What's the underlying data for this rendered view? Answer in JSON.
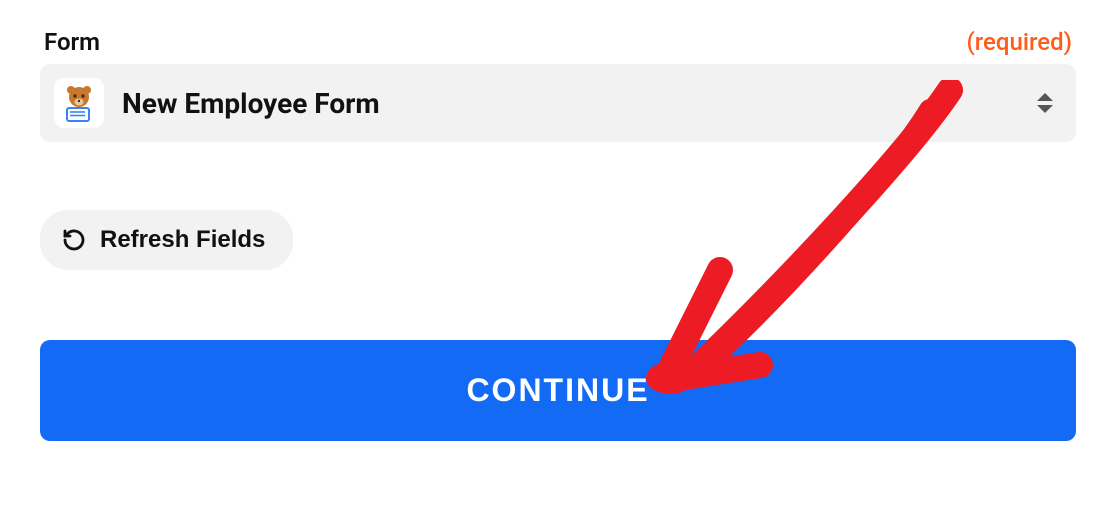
{
  "field": {
    "label": "Form",
    "required_text": "(required)",
    "selected": "New Employee Form",
    "app_icon": "wpforms-bear-icon"
  },
  "refresh": {
    "label": "Refresh Fields"
  },
  "continue": {
    "label": "CONTINUE"
  },
  "colors": {
    "accent": "#136bf5",
    "required": "#ff5c1a",
    "annotation": "#ed1c24"
  }
}
